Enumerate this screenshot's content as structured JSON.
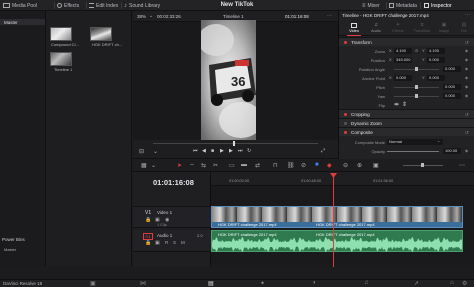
{
  "topbar": {
    "media_pool": "Media Pool",
    "effects": "Effects",
    "edit_index": "Edit Index",
    "sound_library": "Sound Library",
    "project_title": "New TikTok",
    "mixer": "Mixer",
    "metadata": "Metadata",
    "inspector": "Inspector"
  },
  "sidebar": {
    "master": "Master",
    "power_bins": "Power Bins",
    "master2": "Master"
  },
  "media_pool": {
    "items": [
      {
        "label": "Compound Cl..."
      },
      {
        "label": "HGK DRIFT ch..."
      },
      {
        "label": "Timeline 1"
      }
    ]
  },
  "viewer": {
    "zoom": "38%",
    "source_tc": "00:02:33:26",
    "timeline_name": "Timeline 1",
    "record_tc": "01:01:16:08"
  },
  "inspector": {
    "clip_title": "Timeline - HGK DRIFT challenge 2017.mp4",
    "tabs": [
      "Video",
      "Audio",
      "Effects",
      "Transition",
      "Image",
      "File"
    ],
    "transform": "Transform",
    "zoom_label": "Zoom",
    "zoom_x": "4.190",
    "zoom_y": "4.190",
    "position_label": "Position",
    "pos_x": "345.000",
    "pos_y": "0.000",
    "rotation_label": "Rotation Angle",
    "rotation": "0.000",
    "anchor_label": "Anchor Point",
    "anchor_x": "0.000",
    "anchor_y": "0.000",
    "pitch_label": "Pitch",
    "pitch": "0.000",
    "yaw_label": "Yaw",
    "yaw": "0.000",
    "flip_label": "Flip",
    "cropping": "Cropping",
    "dynamic_zoom": "Dynamic Zoom",
    "composite": "Composite",
    "composite_mode_label": "Composite Mode",
    "composite_mode": "Normal",
    "opacity_label": "Opacity",
    "opacity": "100.00"
  },
  "timeline": {
    "timecode": "01:01:16:08",
    "ruler": [
      "01:00:00:00",
      "01:00:48:00",
      "01:01:36:00"
    ],
    "video_track": {
      "id": "V1",
      "name": "Video 1",
      "info": "1 Clip"
    },
    "audio_track": {
      "id": "A1",
      "name": "Audio 1",
      "level": "2.0"
    },
    "clip_name": "HGK DRIFT challenge 2017.mp4"
  },
  "bottom": {
    "app": "DaVinci Resolve 18"
  },
  "colors": {
    "accent": "#e23b3b",
    "audio": "#3f9e6a",
    "video": "#3a6e9c",
    "bg": "#1c1c1e"
  }
}
